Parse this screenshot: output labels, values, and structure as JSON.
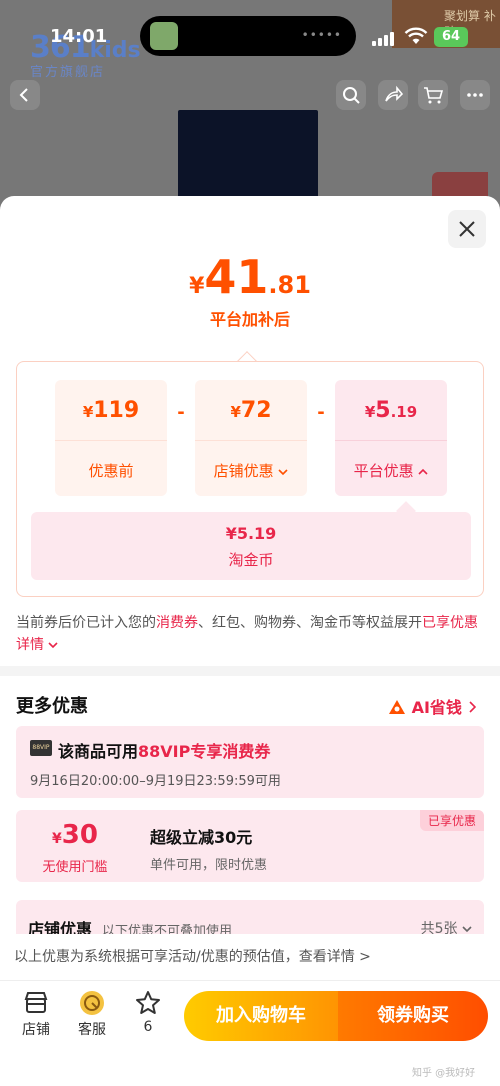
{
  "status_bar": {
    "time": "14:01",
    "battery": "64"
  },
  "background": {
    "brand_big": "361",
    "brand_kids": "kids",
    "brand_sub": "官方旗舰店",
    "promo_corner": "聚划算 补贴"
  },
  "hero": {
    "currency": "¥",
    "price_int": "41",
    "price_dec": ".81",
    "caption": "平台加补后"
  },
  "breakdown": {
    "cells": [
      {
        "currency": "¥",
        "value": "119",
        "decimal": "",
        "label": "优惠前"
      },
      {
        "currency": "¥",
        "value": "72",
        "decimal": "",
        "label": "店铺优惠"
      },
      {
        "currency": "¥",
        "value": "5",
        "decimal": ".19",
        "label": "平台优惠"
      }
    ],
    "operator": "-",
    "sub": {
      "value": "¥5.19",
      "label": "淘金币"
    }
  },
  "note": {
    "part1": "当前券后价已计入您的",
    "highlight1": "消费券",
    "part2": "、红包、购物券、淘金币等权益展开",
    "link": "已享优惠详情"
  },
  "more": {
    "title": "更多优惠",
    "ai_link": "AI省钱"
  },
  "vip": {
    "badge": "88VIP",
    "title_prefix": "该商品可用",
    "title_highlight": "88VIP专享消费券",
    "time": "9月16日20:00:00–9月19日23:59:59可用"
  },
  "coupon": {
    "currency": "¥",
    "amount": "30",
    "condition": "无使用门槛",
    "title": "超级立减30元",
    "desc": "单件可用，限时优惠",
    "badge": "已享优惠"
  },
  "shop": {
    "title": "店铺优惠",
    "sub": "以下优惠不可叠加使用",
    "count": "共5张"
  },
  "disclaimer": "以上优惠为系统根据可享活动/优惠的预估值，查看详情 >",
  "bottom": {
    "store": "店铺",
    "service": "客服",
    "fav_count": "6",
    "add_cart": "加入购物车",
    "buy": "领券购买"
  },
  "watermark": "知乎 @我好好",
  "colors": {
    "primary_orange": "#ff5000",
    "accent_red": "#e8264a"
  }
}
